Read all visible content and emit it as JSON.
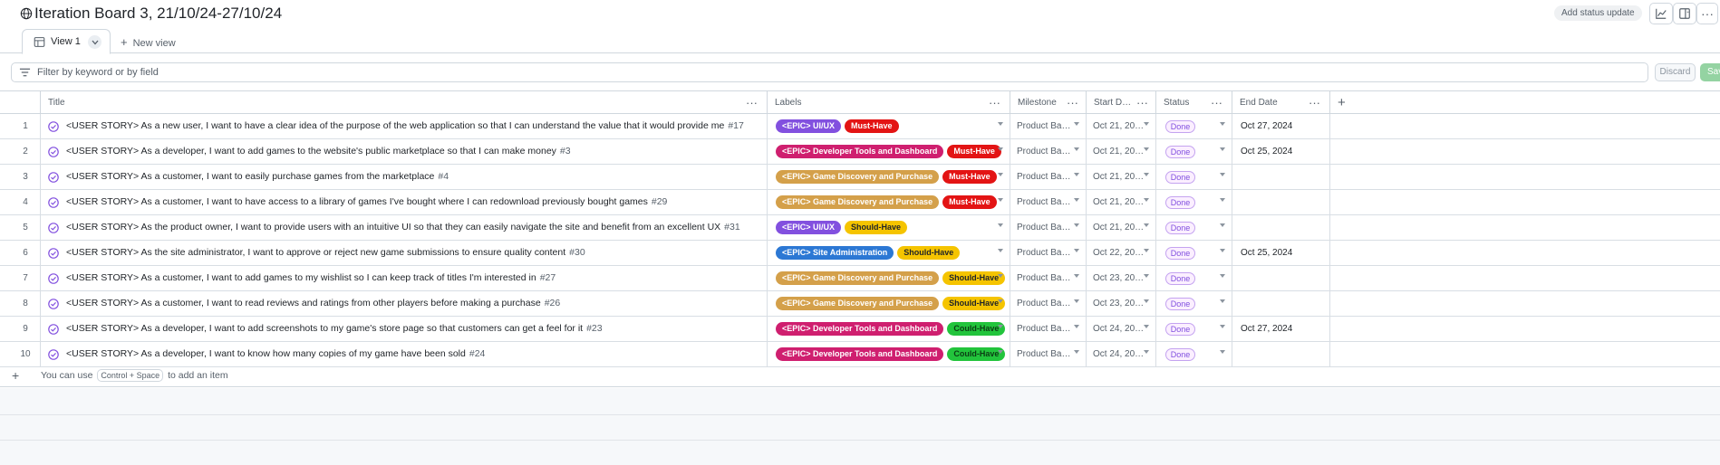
{
  "header": {
    "title": "Iteration Board 3, 21/10/24-27/10/24",
    "status_update_button": "Add status update"
  },
  "tabs": {
    "view1_label": "View 1",
    "new_view_label": "New view"
  },
  "filter": {
    "placeholder": "Filter by keyword or by field",
    "discard_label": "Discard",
    "save_label": "Save"
  },
  "columns": {
    "title": "Title",
    "labels": "Labels",
    "milestone": "Milestone",
    "start_date": "Start D…",
    "status": "Status",
    "end_date": "End Date"
  },
  "colors": {
    "uiux": "#8250df",
    "devtools": "#cf1f6f",
    "gamedisc": "#d4a04a",
    "siteadmin": "#2c78d4",
    "musthave": "#e31414",
    "shouldhave": "#f5c400",
    "couldhave": "#22c43c"
  },
  "rows": [
    {
      "num": "1",
      "title": "<USER STORY> As a new user, I want to have a clear idea of the purpose of the web application so that I can understand the value that it would provide me",
      "issue": "#17",
      "labels": [
        {
          "text": "<EPIC> UI/UX",
          "color": "uiux"
        },
        {
          "text": "Must-Have",
          "color": "musthave"
        }
      ],
      "milestone": "Product Ba…",
      "start": "Oct 21, 20…",
      "status": "Done",
      "end": "Oct 27, 2024"
    },
    {
      "num": "2",
      "title": "<USER STORY> As a developer, I want to add games to the website's public marketplace so that I can make money",
      "issue": "#3",
      "labels": [
        {
          "text": "<EPIC> Developer Tools and Dashboard",
          "color": "devtools"
        },
        {
          "text": "Must-Have",
          "color": "musthave"
        }
      ],
      "milestone": "Product Ba…",
      "start": "Oct 21, 20…",
      "status": "Done",
      "end": "Oct 25, 2024"
    },
    {
      "num": "3",
      "title": "<USER STORY> As a customer, I want to easily purchase games from the marketplace",
      "issue": "#4",
      "labels": [
        {
          "text": "<EPIC> Game Discovery and Purchase",
          "color": "gamedisc"
        },
        {
          "text": "Must-Have",
          "color": "musthave"
        }
      ],
      "milestone": "Product Ba…",
      "start": "Oct 21, 20…",
      "status": "Done",
      "end": ""
    },
    {
      "num": "4",
      "title": "<USER STORY> As a customer, I want to have access to a library of games I've bought where I can redownload previously bought games",
      "issue": "#29",
      "labels": [
        {
          "text": "<EPIC> Game Discovery and Purchase",
          "color": "gamedisc"
        },
        {
          "text": "Must-Have",
          "color": "musthave"
        }
      ],
      "milestone": "Product Ba…",
      "start": "Oct 21, 20…",
      "status": "Done",
      "end": ""
    },
    {
      "num": "5",
      "title": "<USER STORY> As the product owner, I want to provide users with an intuitive UI so that they can easily navigate the site and benefit from an excellent UX",
      "issue": "#31",
      "labels": [
        {
          "text": "<EPIC> UI/UX",
          "color": "uiux"
        },
        {
          "text": "Should-Have",
          "color": "shouldhave"
        }
      ],
      "milestone": "Product Ba…",
      "start": "Oct 21, 20…",
      "status": "Done",
      "end": ""
    },
    {
      "num": "6",
      "title": "<USER STORY> As the site administrator, I want to approve or reject new game submissions to ensure quality content",
      "issue": "#30",
      "labels": [
        {
          "text": "<EPIC> Site Administration",
          "color": "siteadmin"
        },
        {
          "text": "Should-Have",
          "color": "shouldhave"
        }
      ],
      "milestone": "Product Ba…",
      "start": "Oct 22, 20…",
      "status": "Done",
      "end": "Oct 25, 2024"
    },
    {
      "num": "7",
      "title": "<USER STORY> As a customer, I want to add games to my wishlist so I can keep track of titles I'm interested in",
      "issue": "#27",
      "labels": [
        {
          "text": "<EPIC> Game Discovery and Purchase",
          "color": "gamedisc"
        },
        {
          "text": "Should-Have",
          "color": "shouldhave"
        }
      ],
      "milestone": "Product Ba…",
      "start": "Oct 23, 20…",
      "status": "Done",
      "end": ""
    },
    {
      "num": "8",
      "title": "<USER STORY> As a customer, I want to read reviews and ratings from other players before making a purchase",
      "issue": "#26",
      "labels": [
        {
          "text": "<EPIC> Game Discovery and Purchase",
          "color": "gamedisc"
        },
        {
          "text": "Should-Have",
          "color": "shouldhave"
        }
      ],
      "milestone": "Product Ba…",
      "start": "Oct 23, 20…",
      "status": "Done",
      "end": ""
    },
    {
      "num": "9",
      "title": "<USER STORY> As a developer, I want to add screenshots to my game's store page so that customers can get a feel for it",
      "issue": "#23",
      "labels": [
        {
          "text": "<EPIC> Developer Tools and Dashboard",
          "color": "devtools"
        },
        {
          "text": "Could-Have",
          "color": "couldhave"
        }
      ],
      "milestone": "Product Ba…",
      "start": "Oct 24, 20…",
      "status": "Done",
      "end": "Oct 27, 2024"
    },
    {
      "num": "10",
      "title": "<USER STORY> As a developer, I want to know how many copies of my game have been sold",
      "issue": "#24",
      "labels": [
        {
          "text": "<EPIC> Developer Tools and Dashboard",
          "color": "devtools"
        },
        {
          "text": "Could-Have",
          "color": "couldhave"
        }
      ],
      "milestone": "Product Ba…",
      "start": "Oct 24, 20…",
      "status": "Done",
      "end": ""
    }
  ],
  "add_item": {
    "prefix": "You can use",
    "shortcut": "Control + Space",
    "suffix": "to add an item"
  }
}
